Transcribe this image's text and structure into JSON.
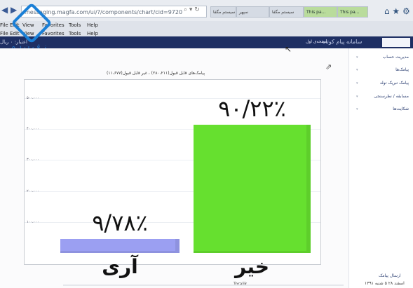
{
  "browser": {
    "url": "messaging.magfa.com/ui/?/components/chart/cid=9720",
    "tabs": [
      {
        "label": "سیستم مگفا",
        "style": "grey"
      },
      {
        "label": "سپهر",
        "style": "grey"
      },
      {
        "label": "سیستم مگفا",
        "style": "grey"
      },
      {
        "label": "This pa...",
        "style": "green"
      },
      {
        "label": "This pa...",
        "style": "green"
      },
      {
        "label": "سیستم مگفا",
        "style": "grey"
      }
    ],
    "menu": [
      "File",
      "Edit",
      "View",
      "Favorites",
      "Tools",
      "Help"
    ]
  },
  "watermark": {
    "text": "ز ف ن د ه"
  },
  "app": {
    "bar_left_text": "اعتبار: ۰ ریال",
    "subtitle": "صفحه‌ی اول",
    "title": "سامانه پیام کوتاه"
  },
  "sidebar": {
    "items": [
      "مدیریت حساب",
      "پیامک‌ها",
      "پیامک تبریک تولد",
      "مسابقه / نظرسنجی",
      "شکایت‌ها"
    ],
    "footer_label": "ارسال پیامک",
    "footer_date": "۱۳۹۱ اسفند ۲۸ ۵ شنبه"
  },
  "chart_data": {
    "type": "bar",
    "title": "پیامک‌های قابل قبول(۲۸۰،۲۱۱) ، غیر قابل قبول(۱۱،۶۷۷)",
    "categories": [
      "آری",
      "خیر"
    ],
    "values": [
      9.78,
      90.22
    ],
    "bar_labels": [
      "۹/۷۸٪",
      "۹۰/۲۲٪"
    ],
    "colors": [
      "#9b9ff2",
      "#66e02f"
    ],
    "ytick_labels": [
      "۵۰۰،۰۰۰",
      "۴۰۰،۰۰۰",
      "۳۰۰،۰۰۰",
      "۲۰۰،۰۰۰",
      "۱۰۰،۰۰۰"
    ],
    "ylim": [
      0,
      100
    ],
    "grid": true,
    "xlabel": "",
    "ylabel": ""
  },
  "bottom": {
    "text": "Toralik"
  }
}
